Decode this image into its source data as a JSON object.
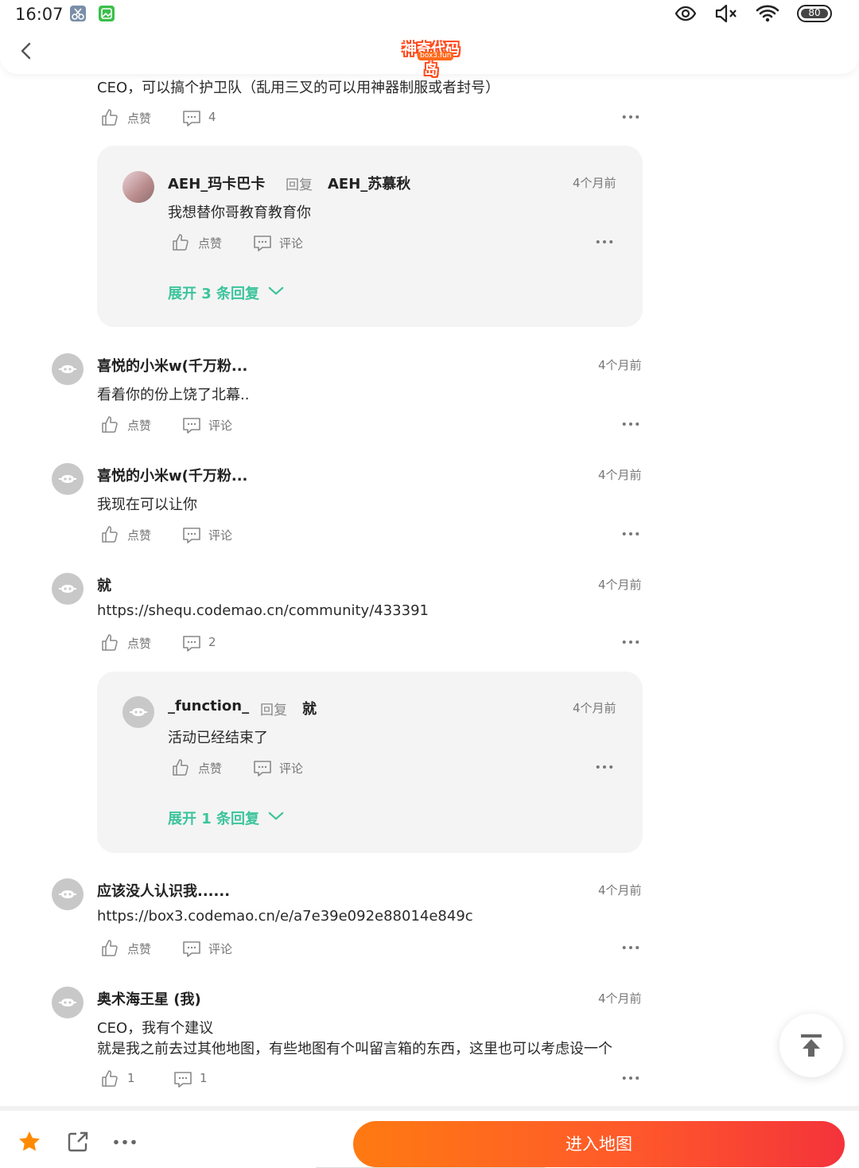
{
  "status_bar": {
    "time": "16:07",
    "battery": "80"
  },
  "header": {
    "logo_text": "神奇代码岛",
    "logo_sub": "box3.fun"
  },
  "top_comment": {
    "text": "CEO，可以搞个护卫队（乱用三叉的可以用神器制服或者封号）",
    "like_label": "点赞",
    "comment_count": "4",
    "reply": {
      "author": "AEH_玛卡巴卡",
      "reply_word": "回复",
      "target": "AEH_苏慕秋",
      "time": "4个月前",
      "text": "我想替你哥教育教育你",
      "like_label": "点赞",
      "comment_label": "评论",
      "expand": "展开 3 条回复"
    }
  },
  "comments": [
    {
      "author": "喜悦的小米w(千万粉...",
      "time": "4个月前",
      "text": "看着你的份上饶了北幕..",
      "like_label": "点赞",
      "comment_label": "评论"
    },
    {
      "author": "喜悦的小米w(千万粉...",
      "time": "4个月前",
      "text": "我现在可以让你",
      "like_label": "点赞",
      "comment_label": "评论"
    },
    {
      "author": "就",
      "time": "4个月前",
      "text": "https://shequ.codemao.cn/community/433391",
      "like_label": "点赞",
      "comment_count": "2",
      "reply": {
        "author": "_function_",
        "reply_word": "回复",
        "target": "就",
        "time": "4个月前",
        "text": "活动已经结束了",
        "like_label": "点赞",
        "comment_label": "评论",
        "expand": "展开 1 条回复"
      }
    },
    {
      "author": "应该没人认识我......",
      "time": "4个月前",
      "text": "https://box3.codemao.cn/e/a7e39e092e88014e849c",
      "like_label": "点赞",
      "comment_label": "评论"
    },
    {
      "author": "奥术海王星 (我)",
      "time": "4个月前",
      "text_line1": "CEO，我有个建议",
      "text_line2": "就是我之前去过其他地图，有些地图有个叫留言箱的东西，这里也可以考虑设一个",
      "like_count": "1",
      "comment_count": "1"
    }
  ],
  "bottom_bar": {
    "enter_label": "进入地图"
  },
  "colors": {
    "accent_green": "#3cc49b",
    "button_orange": "#ff7a12",
    "button_red": "#f4333b",
    "star": "#ff8a00"
  }
}
